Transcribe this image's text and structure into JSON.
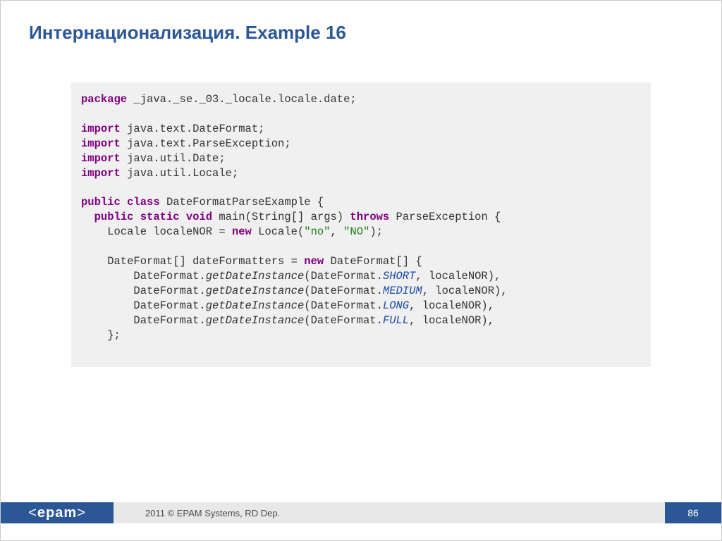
{
  "title": "Интернационализация. Example 16",
  "code": {
    "kw_package": "package",
    "pkg_name": " _java._se._03._locale.locale.date;",
    "kw_import": "import",
    "imp1": " java.text.DateFormat;",
    "imp2": " java.text.ParseException;",
    "imp3": " java.util.Date;",
    "imp4": " java.util.Locale;",
    "kw_public": "public",
    "kw_class": "class",
    "class_decl": " DateFormatParseExample {",
    "kw_static": "static",
    "kw_void": "void",
    "main_sig1": " main(String[] args) ",
    "kw_throws": "throws",
    "main_sig2": " ParseException {",
    "locale_line1": "    Locale localeNOR = ",
    "kw_new": "new",
    "locale_line2": " Locale(",
    "str_no": "\"no\"",
    "comma": ", ",
    "str_NO": "\"NO\"",
    "locale_line3": ");",
    "df_line1": "    DateFormat[] dateFormatters = ",
    "df_line2": " DateFormat[] {",
    "call_prefix": "        DateFormat.",
    "meth_getDateInstance": "getDateInstance",
    "call_mid": "(DateFormat.",
    "const_SHORT": "SHORT",
    "const_MEDIUM": "MEDIUM",
    "const_LONG": "LONG",
    "const_FULL": "FULL",
    "call_suffix": ", localeNOR),",
    "close_array": "    };"
  },
  "footer": {
    "logo": "<epam>",
    "copyright": "2011 © EPAM Systems, RD Dep.",
    "page": "86"
  }
}
